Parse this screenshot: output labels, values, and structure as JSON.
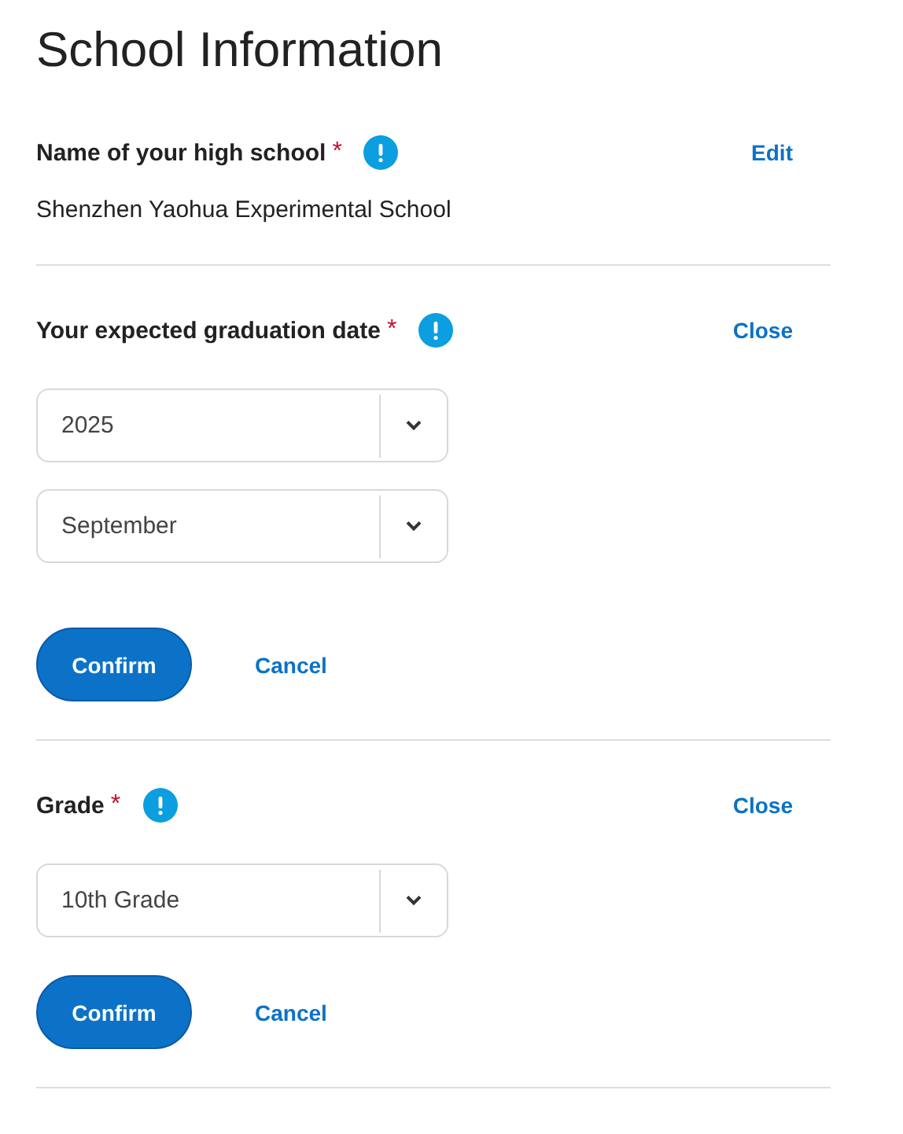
{
  "title": "School Information",
  "sections": [
    {
      "kind": "display",
      "label": "Name of your high school",
      "required_mark": "*",
      "action": "Edit",
      "value": "Shenzhen Yaohua Experimental School"
    },
    {
      "kind": "edit",
      "label": "Your expected graduation date",
      "required_mark": "*",
      "action": "Close",
      "selects": [
        "2025",
        "September"
      ],
      "confirm": "Confirm",
      "cancel": "Cancel"
    },
    {
      "kind": "edit",
      "label": "Grade",
      "required_mark": "*",
      "action": "Close",
      "selects": [
        "10th Grade"
      ],
      "confirm": "Confirm",
      "cancel": "Cancel"
    }
  ]
}
